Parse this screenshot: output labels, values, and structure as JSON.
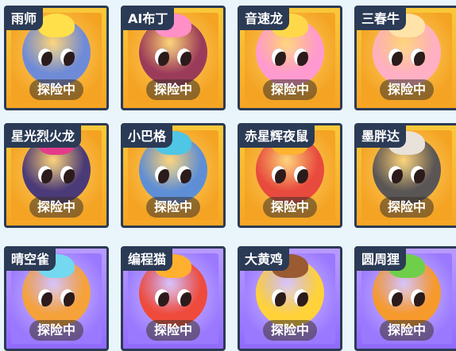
{
  "pets": [
    {
      "name": "雨师",
      "status": "探险中",
      "frame": "gold",
      "color": "#6f8bd8",
      "crest": "#ffe04a"
    },
    {
      "name": "AI布丁",
      "status": "探险中",
      "frame": "gold",
      "color": "#9b3b5a",
      "crest": "#ff8fc7"
    },
    {
      "name": "音速龙",
      "status": "探险中",
      "frame": "gold",
      "color": "#ff9ad1",
      "crest": "#ffd84a"
    },
    {
      "name": "三春牛",
      "status": "探险中",
      "frame": "gold",
      "color": "#ffb0c4",
      "crest": "#ffe3a8"
    },
    {
      "name": "星光烈火龙",
      "status": "探险中",
      "frame": "gold",
      "color": "#4a3a78",
      "crest": "#e23b8a"
    },
    {
      "name": "小巴格",
      "status": "探险中",
      "frame": "gold",
      "color": "#5e8fd6",
      "crest": "#4fc6e6"
    },
    {
      "name": "赤星辉夜鼠",
      "status": "探险中",
      "frame": "gold",
      "color": "#e84a3e",
      "crest": "#ffb32e"
    },
    {
      "name": "墨胖达",
      "status": "探险中",
      "frame": "gold",
      "color": "#5a5656",
      "crest": "#e9e2da"
    },
    {
      "name": "晴空雀",
      "status": "探险中",
      "frame": "purple",
      "color": "#f6a23a",
      "crest": "#74d8f0"
    },
    {
      "name": "编程猫",
      "status": "探险中",
      "frame": "purple",
      "color": "#ef4b3c",
      "crest": "#ffb02e"
    },
    {
      "name": "大黄鸡",
      "status": "探险中",
      "frame": "purple",
      "color": "#ffd23a",
      "crest": "#9a5a32"
    },
    {
      "name": "圆周狸",
      "status": "探险中",
      "frame": "purple",
      "color": "#f79a2c",
      "crest": "#6fcf4a"
    }
  ]
}
